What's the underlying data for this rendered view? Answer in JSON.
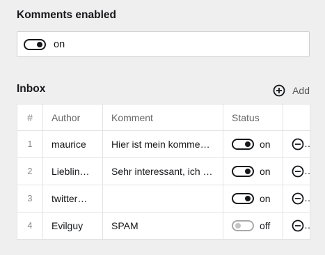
{
  "komments": {
    "title": "Komments enabled",
    "toggle_label": "on",
    "enabled": true
  },
  "inbox": {
    "title": "Inbox",
    "add_label": "Add",
    "columns": [
      "#",
      "Author",
      "Komment",
      "Status"
    ],
    "rows": [
      {
        "num": "1",
        "author": "maurice",
        "komment": "Hier ist mein komme…",
        "status": "on",
        "enabled": true
      },
      {
        "num": "2",
        "author": "Lieblin…",
        "komment": "Sehr interessant, ich …",
        "status": "on",
        "enabled": true
      },
      {
        "num": "3",
        "author": "twitter…",
        "komment": "",
        "status": "on",
        "enabled": true
      },
      {
        "num": "4",
        "author": "Evilguy",
        "komment": "SPAM",
        "status": "off",
        "enabled": false
      }
    ]
  },
  "icons": {
    "add": "plus-circle-icon",
    "remove": "minus-circle-icon"
  }
}
